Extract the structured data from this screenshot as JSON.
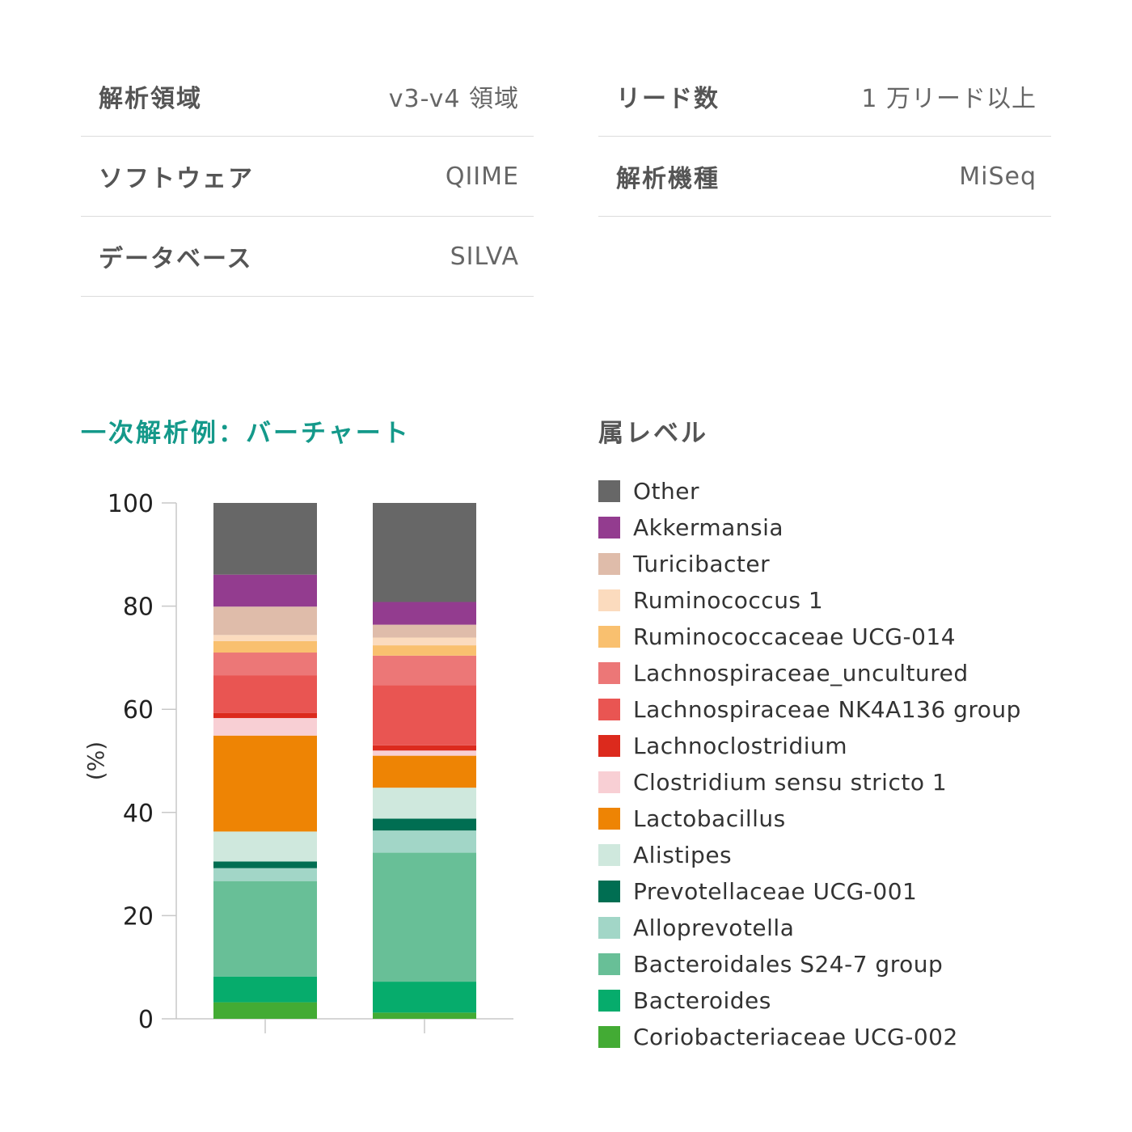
{
  "info": {
    "left": [
      {
        "label": "解析領域",
        "value": "v3-v4 領域"
      },
      {
        "label": "ソフトウェア",
        "value": "QIIME"
      },
      {
        "label": "データベース",
        "value": "SILVA"
      }
    ],
    "right": [
      {
        "label": "リード数",
        "value": "1 万リード以上"
      },
      {
        "label": "解析機種",
        "value": "MiSeq"
      }
    ]
  },
  "chart_title": "一次解析例：バーチャート",
  "legend_title": "属レベル",
  "chart_data": {
    "type": "bar",
    "stacked": true,
    "ylabel": "(%)",
    "ylim": [
      0,
      100
    ],
    "yticks": [
      0,
      20,
      40,
      60,
      80,
      100
    ],
    "categories": [
      "",
      ""
    ],
    "series": [
      {
        "name": "Coriobacteriaceae UCG-002",
        "color": "#43ab34",
        "values": [
          3.2,
          1.2
        ]
      },
      {
        "name": "Bacteroides",
        "color": "#06ac6c",
        "values": [
          5.0,
          6.0
        ]
      },
      {
        "name": "Bacteroidales S24-7 group",
        "color": "#68bf97",
        "values": [
          18.5,
          25.0
        ]
      },
      {
        "name": "Alloprevotella",
        "color": "#a2d6c7",
        "values": [
          2.5,
          4.3
        ]
      },
      {
        "name": "Prevotellaceae UCG-001",
        "color": "#006e52",
        "values": [
          1.3,
          2.3
        ]
      },
      {
        "name": "Alistipes",
        "color": "#cfe8dd",
        "values": [
          5.8,
          6.0
        ]
      },
      {
        "name": "Lactobacillus",
        "color": "#ee8404",
        "values": [
          18.6,
          6.2
        ]
      },
      {
        "name": "Clostridium sensu stricto 1",
        "color": "#f8cfd4",
        "values": [
          3.4,
          1.0
        ]
      },
      {
        "name": "Lachnoclostridium",
        "color": "#dc2a1d",
        "values": [
          1.0,
          1.0
        ]
      },
      {
        "name": "Lachnospiraceae NK4A136 group",
        "color": "#e95552",
        "values": [
          7.3,
          11.7
        ]
      },
      {
        "name": "Lachnospiraceae_uncultured",
        "color": "#ec7777",
        "values": [
          4.4,
          5.7
        ]
      },
      {
        "name": "Ruminococcaceae UCG-014",
        "color": "#f9c06f",
        "values": [
          2.2,
          2.0
        ]
      },
      {
        "name": "Ruminococcus 1",
        "color": "#fbdbbe",
        "values": [
          1.2,
          1.5
        ]
      },
      {
        "name": "Turicibacter",
        "color": "#dfbcaa",
        "values": [
          5.5,
          2.5
        ]
      },
      {
        "name": "Akkermansia",
        "color": "#933c8f",
        "values": [
          6.2,
          4.4
        ]
      },
      {
        "name": "Other",
        "color": "#676767",
        "values": [
          13.9,
          19.2
        ]
      }
    ]
  }
}
